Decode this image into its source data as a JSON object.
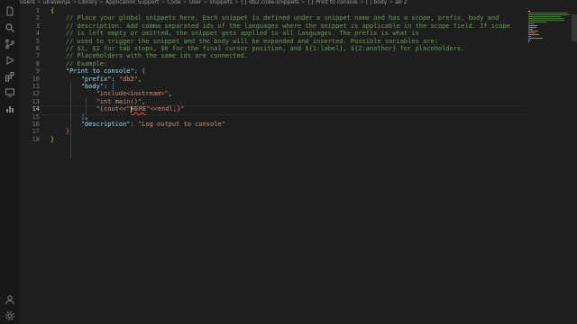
{
  "breadcrumb": {
    "items": [
      "Users",
      "ubaswinja",
      "Library",
      "Application Support",
      "Code",
      "User",
      "snippets",
      "{} db2.code-snippets",
      "{} Print to console",
      "[ ] body",
      "ab 2"
    ]
  },
  "activity_bar": {
    "icons": [
      "files-icon",
      "search-icon",
      "source-control-icon",
      "run-debug-icon",
      "extensions-icon",
      "remote-explorer-icon",
      "charts-icon",
      "account-icon",
      "settings-gear-icon"
    ]
  },
  "editor": {
    "active_line": 14,
    "lines": [
      {
        "n": "1",
        "tokens": [
          {
            "t": "{",
            "c": "c-brace"
          }
        ]
      },
      {
        "n": "2",
        "tokens": [
          {
            "t": "    // Place your global snippets here. Each snippet is defined under a snippet name and has a scope, prefix, body and",
            "c": "c-comment"
          }
        ]
      },
      {
        "n": "3",
        "tokens": [
          {
            "t": "    // description. Add comma separated ids of the languages where the snippet is applicable in the scope field. If scope",
            "c": "c-comment"
          }
        ]
      },
      {
        "n": "4",
        "tokens": [
          {
            "t": "    // is left empty or omitted, the snippet gets applied to all languages. The prefix is what is",
            "c": "c-comment"
          }
        ]
      },
      {
        "n": "5",
        "tokens": [
          {
            "t": "    // used to trigger the snippet and the body will be expanded and inserted. Possible variables are:",
            "c": "c-comment"
          }
        ]
      },
      {
        "n": "6",
        "tokens": [
          {
            "t": "    // $1, $2 for tab stops, $0 for the final cursor position, and ${1:label}, ${2:another} for placeholders.",
            "c": "c-comment"
          }
        ]
      },
      {
        "n": "7",
        "tokens": [
          {
            "t": "    // Placeholders with the same ids are connected.",
            "c": "c-comment"
          }
        ]
      },
      {
        "n": "8",
        "tokens": [
          {
            "t": "    // Example:",
            "c": "c-comment"
          }
        ]
      },
      {
        "n": "9",
        "tokens": [
          {
            "t": "    ",
            "c": "c-punc"
          },
          {
            "t": "\"Print to console\"",
            "c": "c-key"
          },
          {
            "t": ": ",
            "c": "c-punc"
          },
          {
            "t": "{",
            "c": "c-brace2"
          }
        ]
      },
      {
        "n": "10",
        "tokens": [
          {
            "t": "        ",
            "c": "c-punc"
          },
          {
            "t": "\"prefix\"",
            "c": "c-key"
          },
          {
            "t": ": ",
            "c": "c-punc"
          },
          {
            "t": "\"db2\"",
            "c": "c-str"
          },
          {
            "t": ",",
            "c": "c-punc"
          }
        ]
      },
      {
        "n": "11",
        "tokens": [
          {
            "t": "        ",
            "c": "c-punc"
          },
          {
            "t": "\"body\"",
            "c": "c-key"
          },
          {
            "t": ": ",
            "c": "c-punc"
          },
          {
            "t": "[",
            "c": "c-brace3"
          }
        ]
      },
      {
        "n": "12",
        "tokens": [
          {
            "t": "            ",
            "c": "c-punc"
          },
          {
            "t": "\"include<iostream>\"",
            "c": "c-str"
          },
          {
            "t": ",",
            "c": "c-punc"
          }
        ]
      },
      {
        "n": "13",
        "tokens": [
          {
            "t": "            ",
            "c": "c-punc"
          },
          {
            "t": "\"int main()\"",
            "c": "c-str"
          },
          {
            "t": ",",
            "c": "c-punc"
          }
        ]
      },
      {
        "n": "14",
        "tokens": [
          {
            "t": "            ",
            "c": "c-punc"
          },
          {
            "t": "\"{cout<<\"",
            "c": "c-str"
          },
          {
            "t": "HERE",
            "c": "here"
          },
          {
            "t": "\"<<endl;}\"",
            "c": "c-str"
          }
        ]
      },
      {
        "n": "15",
        "tokens": [
          {
            "t": "        ",
            "c": "c-punc"
          },
          {
            "t": "]",
            "c": "c-brace3"
          },
          {
            "t": ",",
            "c": "c-punc"
          }
        ]
      },
      {
        "n": "16",
        "tokens": [
          {
            "t": "        ",
            "c": "c-punc"
          },
          {
            "t": "\"description\"",
            "c": "c-key"
          },
          {
            "t": ": ",
            "c": "c-punc"
          },
          {
            "t": "\"Log output to console\"",
            "c": "c-str"
          }
        ]
      },
      {
        "n": "17",
        "tokens": [
          {
            "t": "    ",
            "c": "c-punc"
          },
          {
            "t": "}",
            "c": "c-brace2"
          }
        ]
      },
      {
        "n": "18",
        "tokens": [
          {
            "t": "}",
            "c": "c-brace"
          }
        ]
      }
    ]
  }
}
